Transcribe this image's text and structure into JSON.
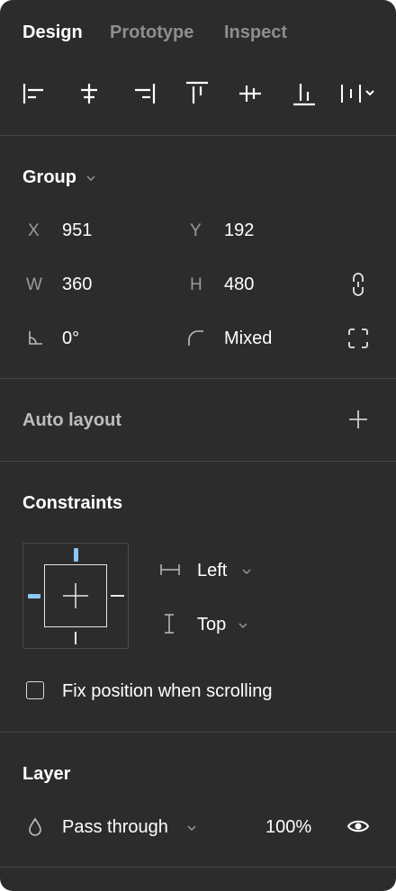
{
  "tabs": [
    {
      "label": "Design",
      "active": true
    },
    {
      "label": "Prototype",
      "active": false
    },
    {
      "label": "Inspect",
      "active": false
    }
  ],
  "alignment_icons": [
    "align-left-icon",
    "align-horizontal-center-icon",
    "align-right-icon",
    "align-top-icon",
    "align-vertical-center-icon",
    "align-bottom-icon",
    "distribute-icon"
  ],
  "group": {
    "title": "Group",
    "x_label": "X",
    "x_value": "951",
    "y_label": "Y",
    "y_value": "192",
    "w_label": "W",
    "w_value": "360",
    "h_label": "H",
    "h_value": "480",
    "rotation_value": "0°",
    "radius_value": "Mixed"
  },
  "auto_layout": {
    "title": "Auto layout"
  },
  "constraints": {
    "title": "Constraints",
    "horizontal": "Left",
    "vertical": "Top",
    "fix_position_label": "Fix position when scrolling",
    "fix_position_checked": false
  },
  "layer": {
    "title": "Layer",
    "blend_mode": "Pass through",
    "opacity": "100%"
  },
  "colors": {
    "panel_bg": "#2c2c2c",
    "separator": "#444444",
    "constraint_active": "#8cc8f5",
    "text_primary": "#ffffff",
    "text_muted": "#9a9a9a"
  }
}
